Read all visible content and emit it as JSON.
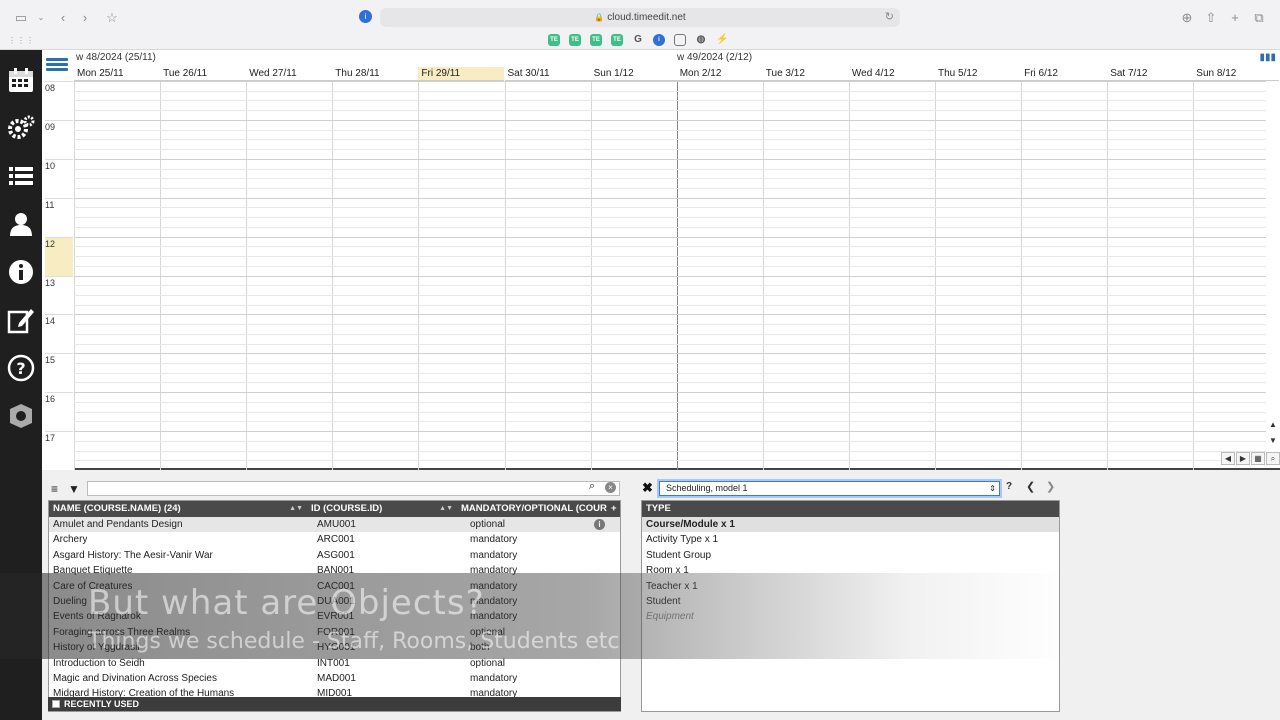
{
  "browser": {
    "url": "cloud.timeedit.net",
    "extensions": [
      "TE",
      "TE",
      "TE",
      "TE",
      "G",
      "1P",
      "box",
      "globe",
      "acrobat"
    ]
  },
  "sidebar": {
    "items": [
      {
        "icon": "calendar-icon"
      },
      {
        "icon": "gears-icon"
      },
      {
        "icon": "list-icon"
      },
      {
        "icon": "user-icon"
      },
      {
        "icon": "info-icon"
      },
      {
        "icon": "edit-icon"
      },
      {
        "icon": "help-icon"
      },
      {
        "icon": "admin-badge-icon"
      }
    ]
  },
  "calendar": {
    "weeks": [
      {
        "label": "w 48/2024 (25/11)"
      },
      {
        "label": "w 49/2024 (2/12)"
      }
    ],
    "days": [
      {
        "label": "Mon 25/11"
      },
      {
        "label": "Tue 26/11"
      },
      {
        "label": "Wed 27/11"
      },
      {
        "label": "Thu 28/11"
      },
      {
        "label": "Fri 29/11",
        "today": true
      },
      {
        "label": "Sat 30/11"
      },
      {
        "label": "Sun 1/12"
      },
      {
        "label": "Mon 2/12"
      },
      {
        "label": "Tue 3/12"
      },
      {
        "label": "Wed 4/12"
      },
      {
        "label": "Thu 5/12"
      },
      {
        "label": "Fri 6/12"
      },
      {
        "label": "Sat 7/12"
      },
      {
        "label": "Sun 8/12"
      }
    ],
    "hours": [
      "08",
      "09",
      "10",
      "11",
      "12",
      "13",
      "14",
      "15",
      "16",
      "17"
    ],
    "current_hour": "12"
  },
  "search": {
    "value": "",
    "placeholder": ""
  },
  "table": {
    "columns": [
      {
        "label": "NAME (COURSE.NAME) (24)"
      },
      {
        "label": "ID (COURSE.ID)"
      },
      {
        "label": "MANDATORY/OPTIONAL (COUR..."
      }
    ],
    "add_label": "+",
    "rows": [
      {
        "name": "Amulet and Pendants Design",
        "id": "AMU001",
        "mo": "optional",
        "selected": true
      },
      {
        "name": "Archery",
        "id": "ARC001",
        "mo": "mandatory"
      },
      {
        "name": "Asgard History: The Aesir-Vanir War",
        "id": "ASG001",
        "mo": "mandatory"
      },
      {
        "name": "Banquet Etiquette",
        "id": "BAN001",
        "mo": "mandatory"
      },
      {
        "name": "Care of Creatures",
        "id": "CAC001",
        "mo": "mandatory"
      },
      {
        "name": "Dueling",
        "id": "DUA001",
        "mo": "mandatory"
      },
      {
        "name": "Events of Ragnarok",
        "id": "EVR001",
        "mo": "mandatory"
      },
      {
        "name": "Foraging across Three Realms",
        "id": "FOR001",
        "mo": "optional"
      },
      {
        "name": "History of Yggdrasil",
        "id": "HYG001",
        "mo": "both"
      },
      {
        "name": "Introduction to Seidh",
        "id": "INT001",
        "mo": "optional"
      },
      {
        "name": "Magic and Divination Across Species",
        "id": "MAD001",
        "mo": "mandatory"
      },
      {
        "name": "Midgard History: Creation of the Humans",
        "id": "MID001",
        "mo": "mandatory"
      }
    ],
    "recently_used_label": "RECENTLY USED"
  },
  "model": {
    "selected": "Scheduling, model 1",
    "help": "?"
  },
  "types": {
    "header": "TYPE",
    "rows": [
      {
        "label": "Course/Module x 1",
        "selected": true
      },
      {
        "label": "Activity Type x 1"
      },
      {
        "label": "Student Group"
      },
      {
        "label": "Room x 1"
      },
      {
        "label": "Teacher x 1"
      },
      {
        "label": "Student"
      },
      {
        "label": "Equipment",
        "italic": true
      }
    ]
  },
  "caption": {
    "line1": "But what are Objects?",
    "line2": "Things we schedule - Staff, Rooms, Students etc"
  }
}
